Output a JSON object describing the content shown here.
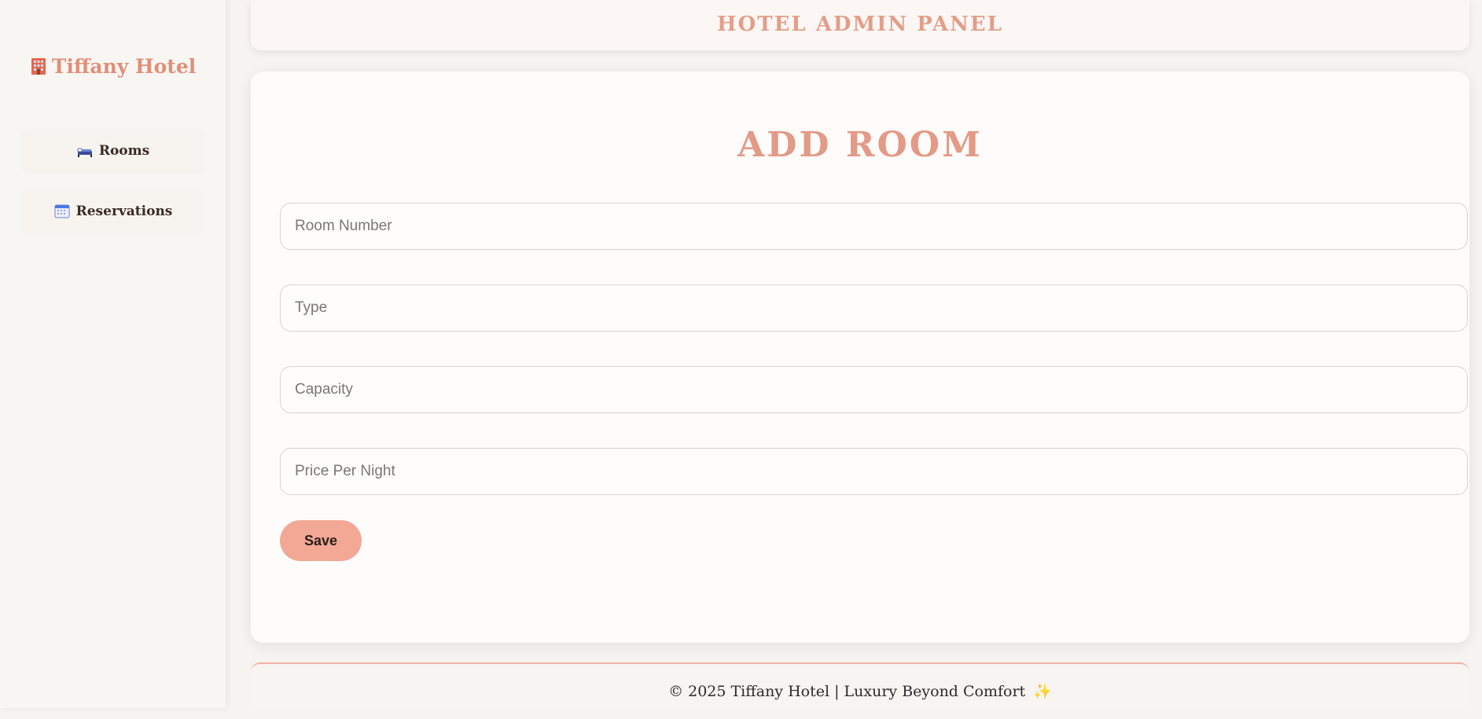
{
  "sidebar": {
    "brand": {
      "icon": "hotel-icon",
      "label": "Tiffany Hotel"
    },
    "items": [
      {
        "icon": "bed-icon",
        "label": "Rooms"
      },
      {
        "icon": "calendar-icon",
        "label": "Reservations"
      }
    ]
  },
  "header": {
    "title": "HOTEL ADMIN PANEL"
  },
  "form": {
    "title": "ADD ROOM",
    "fields": [
      {
        "placeholder": "Room Number",
        "value": ""
      },
      {
        "placeholder": "Type",
        "value": ""
      },
      {
        "placeholder": "Capacity",
        "value": ""
      },
      {
        "placeholder": "Price Per Night",
        "value": ""
      }
    ],
    "save_label": "Save"
  },
  "footer": {
    "text": "© 2025 Tiffany Hotel | Luxury Beyond Comfort",
    "icon": "sparkles-icon"
  },
  "colors": {
    "accent": "#e39a86",
    "button": "#f2a895",
    "background": "#f6f3f0"
  }
}
